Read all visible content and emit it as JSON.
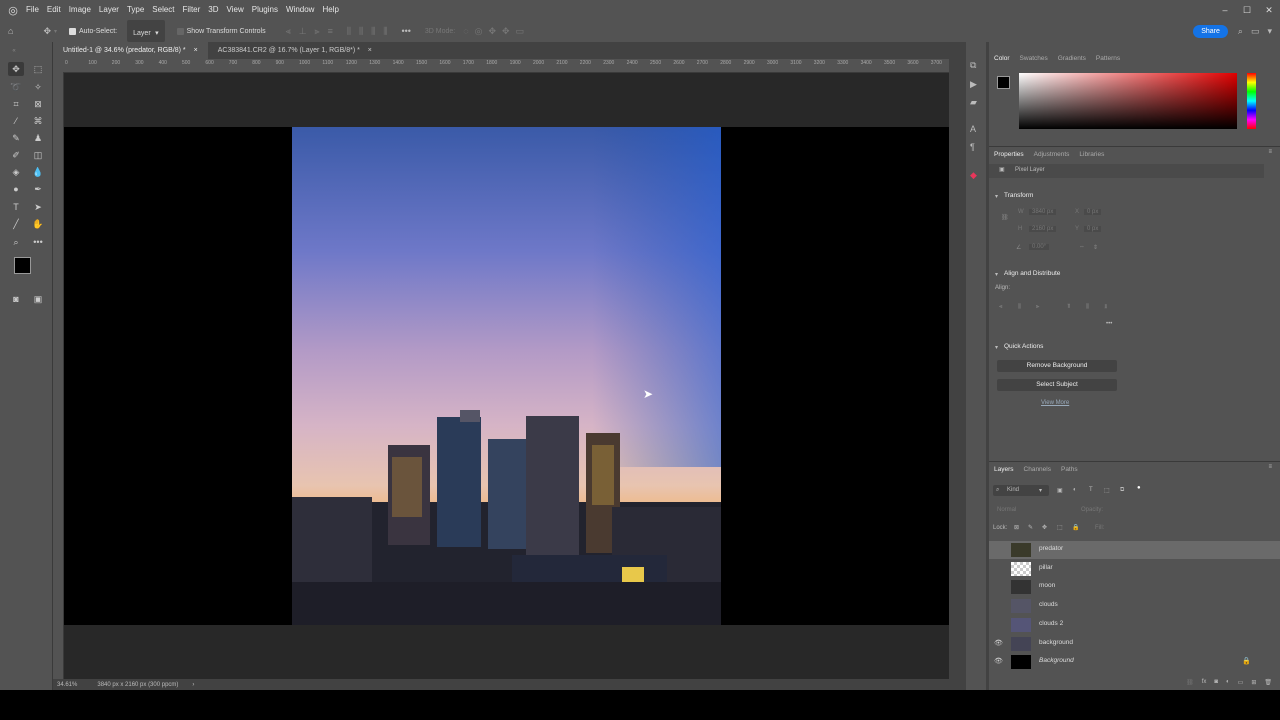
{
  "menubar": {
    "items": [
      "File",
      "Edit",
      "Image",
      "Layer",
      "Type",
      "Select",
      "Filter",
      "3D",
      "View",
      "Plugins",
      "Window",
      "Help"
    ],
    "window_buttons": [
      "–",
      "☐",
      "✕"
    ]
  },
  "optbar": {
    "auto_select_label": "Auto-Select:",
    "layer_select": "Layer",
    "show_transform_label": "Show Transform Controls",
    "mode_3d_label": "3D Mode:",
    "share_label": "Share"
  },
  "tabs": [
    {
      "label": "Untitled-1 @ 34.6% (predator, RGB/8) *",
      "close": "×"
    },
    {
      "label": "AC383841.CR2 @ 16.7% (Layer 1, RGB/8*) *",
      "close": "×"
    }
  ],
  "ruler_ticks": [
    "0",
    "100",
    "200",
    "300",
    "400",
    "500",
    "600",
    "700",
    "800",
    "900",
    "1000",
    "1100",
    "1200",
    "1300",
    "1400",
    "1500",
    "1600",
    "1700",
    "1800",
    "1900",
    "2000",
    "2100",
    "2200",
    "2300",
    "2400",
    "2500",
    "2600",
    "2700",
    "2800",
    "2900",
    "3000",
    "3100",
    "3200",
    "3300",
    "3400",
    "3500",
    "3600",
    "3700"
  ],
  "status": {
    "zoom": "34.61%",
    "doc_info": "3840 px x 2160 px (300 ppcm)"
  },
  "color_panel": {
    "tabs": [
      "Color",
      "Swatches",
      "Gradients",
      "Patterns"
    ],
    "field_hue": "#e00000"
  },
  "properties_panel": {
    "tabs": [
      "Properties",
      "Adjustments",
      "Libraries"
    ],
    "layer_type": "Pixel Layer",
    "transform_title": "Transform",
    "transform_fields": {
      "w_label": "W",
      "w_value": "3840 px",
      "x_label": "X",
      "x_value": "0 px",
      "h_label": "H",
      "h_value": "2160 px",
      "y_label": "Y",
      "y_value": "0 px",
      "angle_value": "0.00°"
    },
    "align_title": "Align and Distribute",
    "align_label": "Align:",
    "more": "•••",
    "quick_actions_title": "Quick Actions",
    "remove_bg": "Remove Background",
    "select_subject": "Select Subject",
    "view_more": "View More"
  },
  "layers_panel": {
    "tabs": [
      "Layers",
      "Channels",
      "Paths"
    ],
    "kind_label": "Kind",
    "blend_mode": "Normal",
    "opacity_label": "Opacity:",
    "lock_label": "Lock:",
    "fill_label": "Fill:",
    "layers": [
      {
        "name": "predator",
        "visible": false,
        "selected": true,
        "italic": false
      },
      {
        "name": "pillar",
        "visible": false,
        "selected": false,
        "italic": false
      },
      {
        "name": "moon",
        "visible": false,
        "selected": false,
        "italic": false
      },
      {
        "name": "clouds",
        "visible": false,
        "selected": false,
        "italic": false
      },
      {
        "name": "clouds 2",
        "visible": false,
        "selected": false,
        "italic": false
      },
      {
        "name": "background",
        "visible": true,
        "selected": false,
        "italic": false
      },
      {
        "name": "Background",
        "visible": true,
        "selected": false,
        "italic": true
      }
    ]
  },
  "colors": {
    "accent": "#1473e6",
    "ui_bg": "#535353",
    "ui_dark": "#424242",
    "pasteboard": "#282828"
  }
}
